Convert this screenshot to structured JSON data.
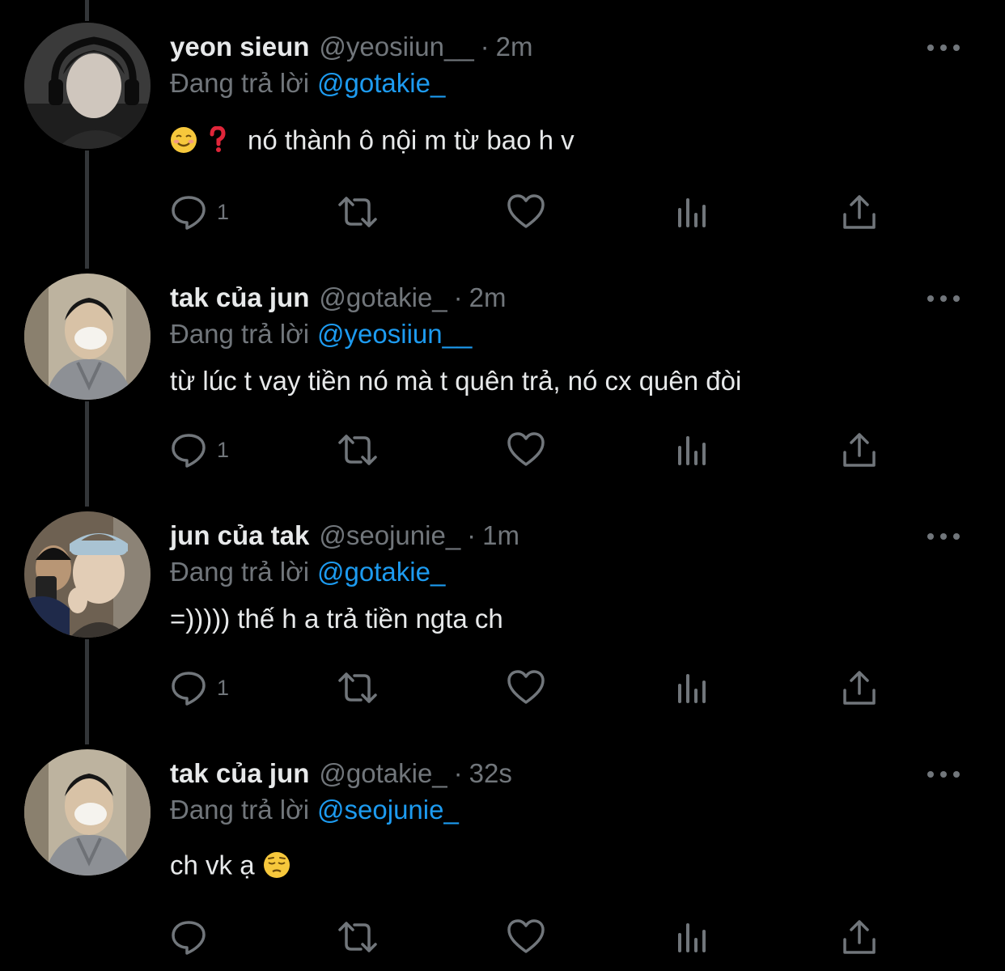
{
  "reply_prefix": "Đang trả lời",
  "tweets": [
    {
      "display_name": "yeon sieun",
      "handle": "@yeosiiun__",
      "separator": "·",
      "time": "2m",
      "replying_to": "@gotakie_",
      "text": "nó thành ô nội m từ bao h v",
      "reply_count": "1"
    },
    {
      "display_name": "tak của jun",
      "handle": "@gotakie_",
      "separator": "·",
      "time": "2m",
      "replying_to": "@yeosiiun__",
      "text": "từ lúc t vay tiền nó mà t quên trả, nó cx quên đòi",
      "reply_count": "1"
    },
    {
      "display_name": "jun của tak",
      "handle": "@seojunie_",
      "separator": "·",
      "time": "1m",
      "replying_to": "@gotakie_",
      "text": "=))))) thế h a trả tiền ngta ch",
      "reply_count": "1"
    },
    {
      "display_name": "tak của jun",
      "handle": "@gotakie_",
      "separator": "·",
      "time": "32s",
      "replying_to": "@seojunie_",
      "text": "ch vk ạ",
      "reply_count": ""
    }
  ],
  "icons": {
    "reply": "reply-icon",
    "retweet": "retweet-icon",
    "like": "heart-icon",
    "views": "views-icon",
    "share": "share-icon",
    "more": "more-dots-icon"
  },
  "colors": {
    "background": "#000000",
    "text_primary": "#e7e9ea",
    "text_secondary": "#71767b",
    "mention": "#1d9bf0",
    "thread_line": "#333639"
  }
}
